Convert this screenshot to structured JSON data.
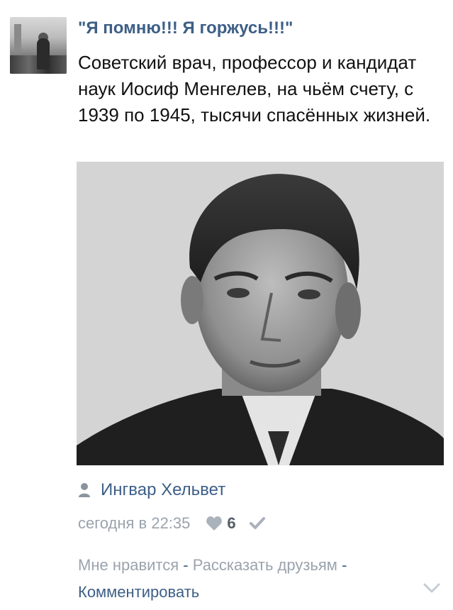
{
  "group": {
    "name": "\"Я помню!!! Я горжусь!!!\""
  },
  "post": {
    "text": "Советский врач, профессор и кандидат наук Иосиф Менгелев, на чьём счету, с 1939 по 1945, тысячи спасённых жизней."
  },
  "author": {
    "name": "Ингвар Хельвет",
    "icon": "person-icon"
  },
  "meta": {
    "timestamp": "сегодня в 22:35",
    "like_count": "6",
    "like_icon": "heart-icon",
    "share_icon": "check-icon"
  },
  "actions": {
    "like": "Мне нравится",
    "separator": "-",
    "share": "Рассказать друзьям",
    "comment": "Комментировать",
    "expand_icon": "chevron-down-icon"
  },
  "colors": {
    "link": "#3d5f86",
    "muted": "#9aa3ad"
  }
}
